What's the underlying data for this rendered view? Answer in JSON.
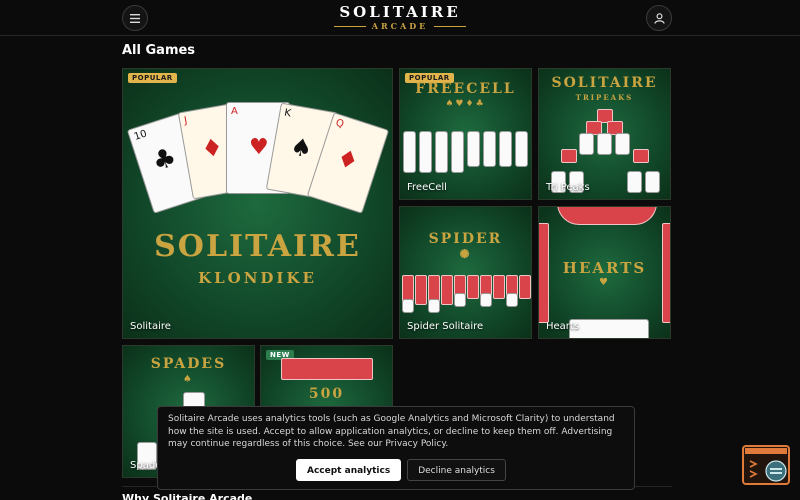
{
  "header": {
    "logo_main": "SOLITAIRE",
    "logo_sub": "ARCADE",
    "menu_icon": "hamburger-icon",
    "user_icon": "user-icon"
  },
  "section": {
    "title": "All Games"
  },
  "tiles": [
    {
      "label": "Solitaire",
      "art_title": "SOLITAIRE",
      "art_subtitle": "KLONDIKE",
      "badge": "POPULAR"
    },
    {
      "label": "FreeCell",
      "art_title": "FREECELL",
      "badge": "POPULAR"
    },
    {
      "label": "Tri Peaks",
      "art_title": "SOLITAIRE",
      "art_subtitle": "TRIPEAKS"
    },
    {
      "label": "Spider Solitaire",
      "art_title": "SPIDER"
    },
    {
      "label": "Hearts",
      "art_title": "HEARTS"
    },
    {
      "label": "Spades",
      "art_title": "SPADES"
    },
    {
      "label": "",
      "badge": "NEW",
      "art_title": "500"
    }
  ],
  "cookie": {
    "text": "Solitaire Arcade uses analytics tools (such as Google Analytics and Microsoft Clarity) to understand how the site is used. Accept to allow application analytics, or decline to keep them off. Advertising may continue regardless of this choice. See our Privacy Policy.",
    "accept_label": "Accept analytics",
    "decline_label": "Decline analytics"
  },
  "bottom_heading": "Why Solitaire Arcade",
  "colors": {
    "accent_gold": "#c9a441",
    "felt_green": "#1e6a3e",
    "badge_popular": "#e2b44c",
    "badge_new": "#2e7d4f",
    "widget_orange": "#e07a3a"
  }
}
